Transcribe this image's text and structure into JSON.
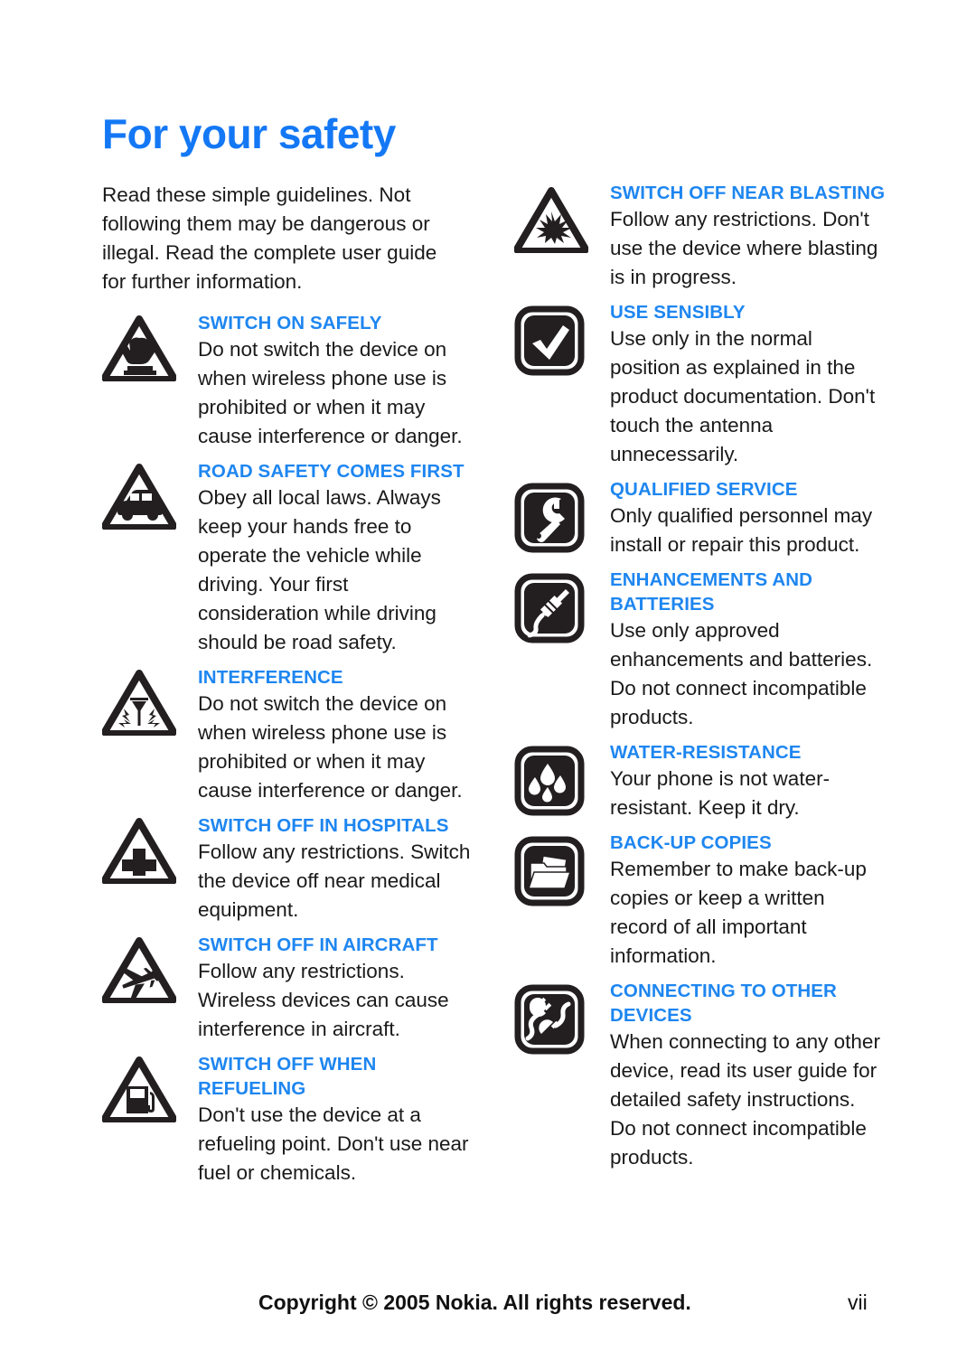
{
  "document": {
    "title": "For your safety",
    "intro": "Read these simple guidelines. Not following them may be dangerous or illegal. Read the complete user guide for further information."
  },
  "colors": {
    "heading_blue": "#1478f5",
    "item_title_blue": "#1e86f0",
    "body_black": "#1a1a1a",
    "page_background": "#ffffff"
  },
  "left_column": [
    {
      "icon": "switch-on-safely-icon",
      "icon_style": "triangle",
      "title": "SWITCH ON SAFELY",
      "body": "Do not switch the device on when wireless phone use is prohibited or when it may cause interference or danger."
    },
    {
      "icon": "road-safety-icon",
      "icon_style": "triangle",
      "title": "ROAD SAFETY COMES FIRST",
      "body": "Obey all local laws. Always keep your hands free to operate the vehicle while driving. Your first consideration while driving should be road safety."
    },
    {
      "icon": "interference-icon",
      "icon_style": "triangle",
      "title": "INTERFERENCE",
      "body": "Do not switch the device on when wireless phone use is prohibited or when it may cause interference or danger."
    },
    {
      "icon": "hospital-cross-icon",
      "icon_style": "triangle",
      "title": "SWITCH OFF IN HOSPITALS",
      "body": "Follow any restrictions. Switch the device off near medical equipment."
    },
    {
      "icon": "aircraft-icon",
      "icon_style": "triangle",
      "title": "SWITCH OFF IN AIRCRAFT",
      "body": "Follow any restrictions. Wireless devices can cause interference in aircraft."
    },
    {
      "icon": "fuel-pump-icon",
      "icon_style": "triangle",
      "title": "SWITCH OFF WHEN REFUELING",
      "body": "Don't use the device at a refueling point. Don't use near fuel or chemicals."
    }
  ],
  "right_column": [
    {
      "icon": "blasting-explosion-icon",
      "icon_style": "triangle",
      "title": "SWITCH OFF NEAR BLASTING",
      "body": "Follow any restrictions. Don't use the device where blasting is in progress."
    },
    {
      "icon": "checkmark-icon",
      "icon_style": "square",
      "title": "USE SENSIBLY",
      "body": "Use only in the normal position as explained in the product documentation. Don't touch the antenna unnecessarily."
    },
    {
      "icon": "wrench-icon",
      "icon_style": "square",
      "title": "QUALIFIED SERVICE",
      "body": "Only qualified personnel may install or repair this product."
    },
    {
      "icon": "charger-plug-icon",
      "icon_style": "square",
      "title": "ENHANCEMENTS AND BATTERIES",
      "body": "Use only approved enhancements and batteries. Do not connect incompatible products."
    },
    {
      "icon": "water-drops-icon",
      "icon_style": "square",
      "title": "WATER-RESISTANCE",
      "body": "Your phone is not water-resistant. Keep it dry."
    },
    {
      "icon": "folder-backup-icon",
      "icon_style": "square",
      "title": "BACK-UP COPIES",
      "body": "Remember to make back-up copies or keep a written record of all important information."
    },
    {
      "icon": "connector-plugs-icon",
      "icon_style": "square",
      "title": "CONNECTING TO OTHER DEVICES",
      "body": "When connecting to any other device, read its user guide for detailed safety instructions. Do not connect incompatible products."
    }
  ],
  "footer": {
    "copyright": "Copyright © 2005 Nokia. All rights reserved.",
    "page_number": "vii"
  }
}
